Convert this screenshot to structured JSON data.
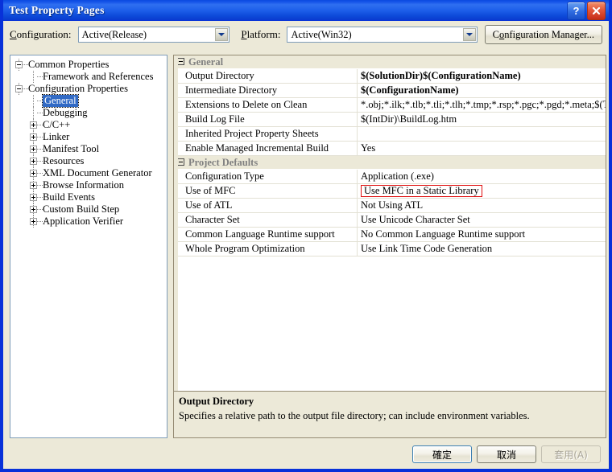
{
  "window": {
    "title": "Test Property Pages",
    "help_button": "?",
    "close_button": "×",
    "accent_titlebar": "#0831d9",
    "dialog_background": "#ece9d8"
  },
  "topbar": {
    "configuration_label": "Configuration:",
    "configuration_accel": "C",
    "configuration_value": "Active(Release)",
    "platform_label": "Platform:",
    "platform_accel": "P",
    "platform_value": "Active(Win32)",
    "config_manager_button": "Configuration Manager...",
    "config_manager_accel": "o"
  },
  "tree": {
    "selected": "General",
    "nodes": [
      {
        "label": "Common Properties",
        "level": 0,
        "toggle": "minus"
      },
      {
        "label": "Framework and References",
        "level": 1,
        "toggle": "none"
      },
      {
        "label": "Configuration Properties",
        "level": 0,
        "toggle": "minus"
      },
      {
        "label": "General",
        "level": 1,
        "toggle": "none",
        "selected": true
      },
      {
        "label": "Debugging",
        "level": 1,
        "toggle": "none"
      },
      {
        "label": "C/C++",
        "level": 1,
        "toggle": "plus"
      },
      {
        "label": "Linker",
        "level": 1,
        "toggle": "plus"
      },
      {
        "label": "Manifest Tool",
        "level": 1,
        "toggle": "plus"
      },
      {
        "label": "Resources",
        "level": 1,
        "toggle": "plus"
      },
      {
        "label": "XML Document Generator",
        "level": 1,
        "toggle": "plus"
      },
      {
        "label": "Browse Information",
        "level": 1,
        "toggle": "plus"
      },
      {
        "label": "Build Events",
        "level": 1,
        "toggle": "plus"
      },
      {
        "label": "Custom Build Step",
        "level": 1,
        "toggle": "plus"
      },
      {
        "label": "Application Verifier",
        "level": 1,
        "toggle": "plus"
      }
    ]
  },
  "grid": {
    "categories": [
      {
        "name": "General",
        "rows": [
          {
            "name": "Output Directory",
            "value": "$(SolutionDir)$(ConfigurationName)",
            "bold": true
          },
          {
            "name": "Intermediate Directory",
            "value": "$(ConfigurationName)",
            "bold": true
          },
          {
            "name": "Extensions to Delete on Clean",
            "value": "*.obj;*.ilk;*.tlb;*.tli;*.tlh;*.tmp;*.rsp;*.pgc;*.pgd;*.meta;$(Targ",
            "bold": false
          },
          {
            "name": "Build Log File",
            "value": "$(IntDir)\\BuildLog.htm",
            "bold": false
          },
          {
            "name": "Inherited Project Property Sheets",
            "value": "",
            "bold": false
          },
          {
            "name": "Enable Managed Incremental Build",
            "value": "Yes",
            "bold": false
          }
        ]
      },
      {
        "name": "Project Defaults",
        "rows": [
          {
            "name": "Configuration Type",
            "value": "Application (.exe)",
            "bold": false
          },
          {
            "name": "Use of MFC",
            "value": "Use MFC in a Static Library",
            "bold": false,
            "highlight": true,
            "highlight_color": "#e01010"
          },
          {
            "name": "Use of ATL",
            "value": "Not Using ATL",
            "bold": false
          },
          {
            "name": "Character Set",
            "value": "Use Unicode Character Set",
            "bold": false
          },
          {
            "name": "Common Language Runtime support",
            "value": "No Common Language Runtime support",
            "bold": false
          },
          {
            "name": "Whole Program Optimization",
            "value": "Use Link Time Code Generation",
            "bold": false
          }
        ]
      }
    ],
    "description": {
      "title": "Output Directory",
      "text": "Specifies a relative path to the output file directory; can include environment variables."
    }
  },
  "buttons": {
    "ok": "確定",
    "cancel": "取消",
    "apply": "套用(A)",
    "apply_disabled": true
  }
}
